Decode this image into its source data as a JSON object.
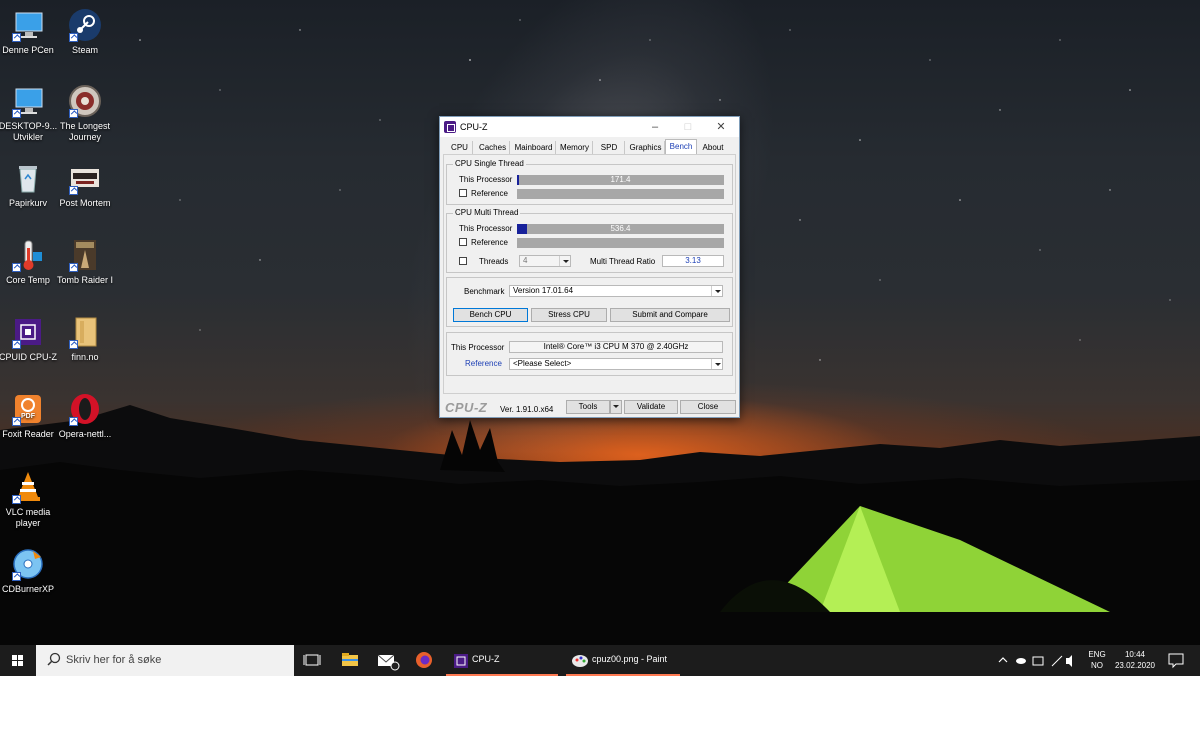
{
  "desktop_icons": [
    {
      "name": "desktop-icon-this-pc",
      "label": "Denne PCen",
      "icon": "computer-icon"
    },
    {
      "name": "desktop-icon-steam",
      "label": "Steam",
      "icon": "steam-icon"
    },
    {
      "name": "desktop-icon-desktop9",
      "label": "DESKTOP-9... Utvikler",
      "icon": "computer-icon"
    },
    {
      "name": "desktop-icon-longest-journey",
      "label": "The Longest Journey",
      "icon": "game-icon"
    },
    {
      "name": "desktop-icon-recycle-bin",
      "label": "Papirkurv",
      "icon": "recycle-bin-icon"
    },
    {
      "name": "desktop-icon-post-mortem",
      "label": "Post Mortem",
      "icon": "game-icon"
    },
    {
      "name": "desktop-icon-core-temp",
      "label": "Core Temp",
      "icon": "thermometer-icon"
    },
    {
      "name": "desktop-icon-tomb-raider",
      "label": "Tomb Raider I",
      "icon": "game-icon"
    },
    {
      "name": "desktop-icon-cpuz",
      "label": "CPUID CPU-Z",
      "icon": "cpu-chip-icon"
    },
    {
      "name": "desktop-icon-finn",
      "label": "finn.no",
      "icon": "folder-icon"
    },
    {
      "name": "desktop-icon-foxit",
      "label": "Foxit Reader",
      "icon": "pdf-icon"
    },
    {
      "name": "desktop-icon-opera",
      "label": "Opera-nettl...",
      "icon": "opera-icon"
    },
    {
      "name": "desktop-icon-vlc",
      "label": "VLC media player",
      "icon": "vlc-cone-icon"
    },
    {
      "name": "desktop-icon-cdburner",
      "label": "CDBurnerXP",
      "icon": "disc-icon"
    }
  ],
  "cpuz": {
    "title": "CPU-Z",
    "tabs": [
      {
        "label": "CPU"
      },
      {
        "label": "Caches"
      },
      {
        "label": "Mainboard"
      },
      {
        "label": "Memory"
      },
      {
        "label": "SPD"
      },
      {
        "label": "Graphics"
      },
      {
        "label": "Bench",
        "active": true
      },
      {
        "label": "About"
      }
    ],
    "single_thread": {
      "group_label": "CPU Single Thread",
      "this_processor_label": "This Processor",
      "this_processor_value": "171.4",
      "reference_label": "Reference"
    },
    "multi_thread": {
      "group_label": "CPU Multi Thread",
      "this_processor_label": "This Processor",
      "this_processor_value": "536.4",
      "reference_label": "Reference",
      "threads_label": "Threads",
      "threads_value": "4",
      "ratio_label": "Multi Thread Ratio",
      "ratio_value": "3.13"
    },
    "bar_scale_fraction": {
      "single": 0.01,
      "multi": 0.05
    },
    "benchmark": {
      "label": "Benchmark",
      "value": "Version 17.01.64",
      "bench_button": "Bench CPU",
      "stress_button": "Stress CPU",
      "submit_button": "Submit and Compare"
    },
    "compare": {
      "this_processor_label": "This Processor",
      "this_processor_value": "Intel® Core™ i3 CPU      M 370  @ 2.40GHz",
      "reference_label": "Reference",
      "reference_value": "<Please Select>"
    },
    "footer": {
      "logo": "CPU-Z",
      "version": "Ver. 1.91.0.x64",
      "tools_button": "Tools",
      "validate_button": "Validate",
      "close_button": "Close"
    }
  },
  "taskbar": {
    "search_placeholder": "Skriv her for å søke",
    "apps": [
      {
        "label": "CPU-Z",
        "icon": "cpu-chip-icon"
      },
      {
        "label": "cpuz00.png - Paint",
        "icon": "paint-palette-icon"
      }
    ],
    "tray": {
      "lang_top": "ENG",
      "lang_bottom": "NO",
      "time": "10:44",
      "date": "23.02.2020"
    }
  },
  "colors": {
    "accent_blue": "#1c3fb5",
    "bar_fill": "#17219a",
    "bar_bg": "#a7a7a7",
    "taskbar": "#1c1c1c",
    "taskbar_underline": "#ff7a52",
    "tent_green": "#9be03a"
  }
}
